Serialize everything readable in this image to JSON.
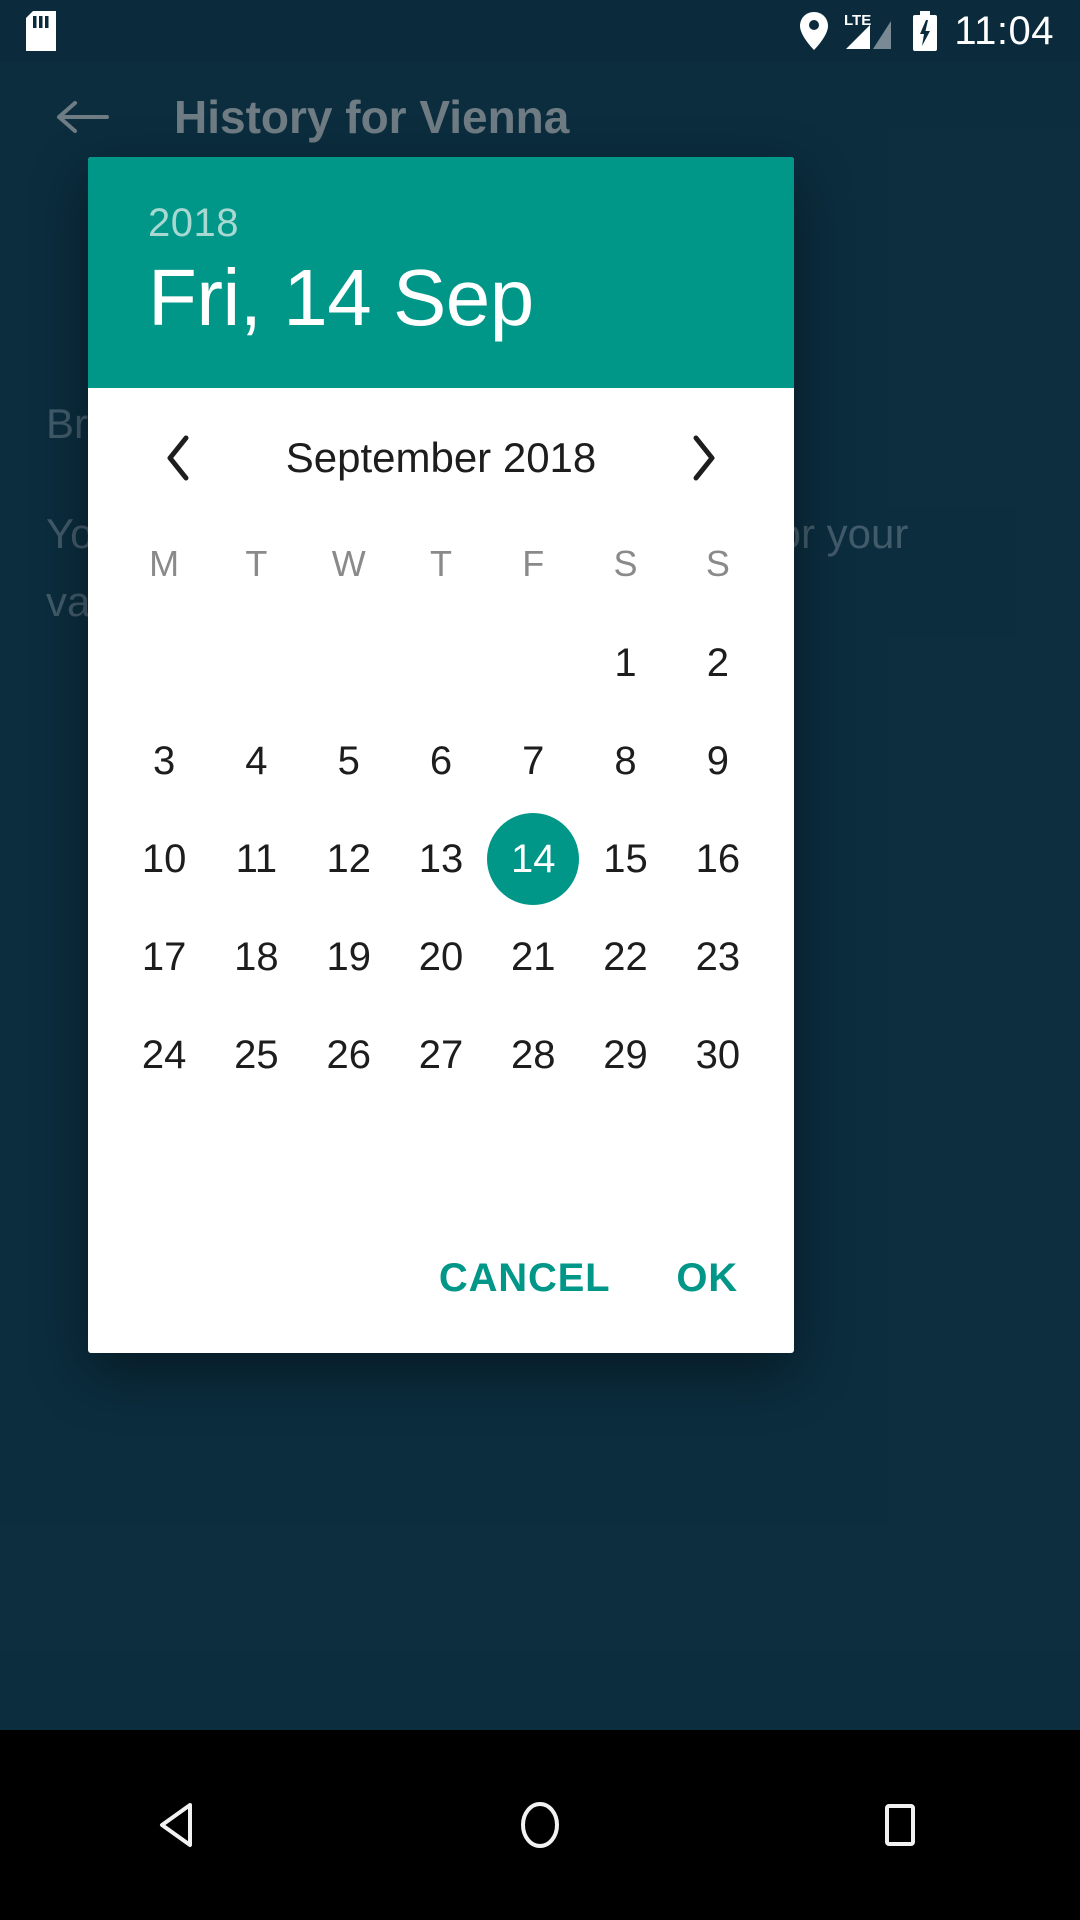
{
  "status_bar": {
    "time": "11:04",
    "network_label": "LTE",
    "icons": [
      "sd-card-icon",
      "location-pin-icon",
      "signal-bars-icon",
      "battery-charging-icon"
    ]
  },
  "app": {
    "back_label": "Back",
    "title": "History for Vienna",
    "body_lines": [
      "Browse weather history day by day",
      "You can look back at the past weather for your vacation"
    ]
  },
  "dialog": {
    "header": {
      "year": "2018",
      "date": "Fri, 14 Sep"
    },
    "calendar": {
      "prev_label": "‹",
      "next_label": "›",
      "month_title": "September 2018",
      "weekdays": [
        "M",
        "T",
        "W",
        "T",
        "F",
        "S",
        "S"
      ],
      "weeks": [
        [
          "",
          "",
          "",
          "",
          "",
          "1",
          "2"
        ],
        [
          "3",
          "4",
          "5",
          "6",
          "7",
          "8",
          "9"
        ],
        [
          "10",
          "11",
          "12",
          "13",
          "14",
          "15",
          "16"
        ],
        [
          "17",
          "18",
          "19",
          "20",
          "21",
          "22",
          "23"
        ],
        [
          "24",
          "25",
          "26",
          "27",
          "28",
          "29",
          "30"
        ],
        [
          "",
          "",
          "",
          "",
          "",
          "",
          ""
        ]
      ],
      "selected_day": "14",
      "selected_row": 2,
      "selected_col": 4
    },
    "actions": {
      "cancel": "CANCEL",
      "ok": "OK"
    }
  },
  "nav_bar": {
    "back": "back-triangle-icon",
    "home": "home-circle-icon",
    "recents": "recents-square-icon"
  },
  "colors": {
    "accent": "#009688",
    "accent_light": "#a8d8d2",
    "app_background": "#0d3346",
    "status_bar": "#0b2b3d",
    "dialog_surface": "#ffffff",
    "nav_bar": "#000000",
    "day_text": "#1d1d1d",
    "weekday_text": "#8a8a8a"
  }
}
